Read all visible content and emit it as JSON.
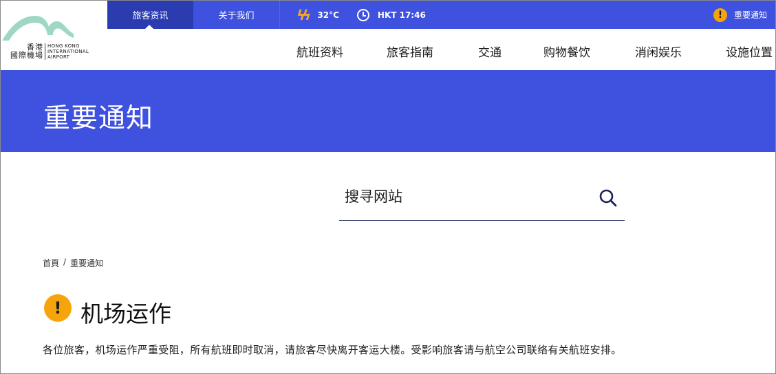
{
  "logo": {
    "zh_line1": "香港",
    "zh_line2": "國際機場",
    "en_line1": "HONG KONG",
    "en_line2": "INTERNATIONAL",
    "en_line3": "AIRPORT",
    "colors": {
      "mark": "#9ed8c4"
    }
  },
  "topbar": {
    "tabs": [
      {
        "label": "旅客资讯",
        "active": true
      },
      {
        "label": "关于我们",
        "active": false
      }
    ],
    "weather": {
      "icon": "lightning-icon",
      "temperature": "32°C"
    },
    "time": {
      "icon": "clock-icon",
      "text": "HKT 17:46"
    },
    "notice": {
      "icon": "warning-icon",
      "label": "重要通知"
    }
  },
  "nav": {
    "items": [
      "航班资料",
      "旅客指南",
      "交通",
      "购物餐饮",
      "消闲娱乐",
      "设施位置"
    ]
  },
  "hero": {
    "title": "重要通知"
  },
  "search": {
    "placeholder": "搜寻网站",
    "icon": "search-icon"
  },
  "breadcrumb": {
    "home": "首頁",
    "separator": "/",
    "current": "重要通知"
  },
  "section": {
    "icon": "warning-icon",
    "title": "机场运作",
    "body": "各位旅客，机场运作严重受阻，所有航班即时取消，请旅客尽快离开客运大楼。受影响旅客请与航空公司联络有关航班安排。"
  },
  "colors": {
    "brand_blue": "#3f51df",
    "active_tab": "#2a3cb0",
    "warning": "#f5a50b",
    "weather_bolt": "#f5a623"
  }
}
